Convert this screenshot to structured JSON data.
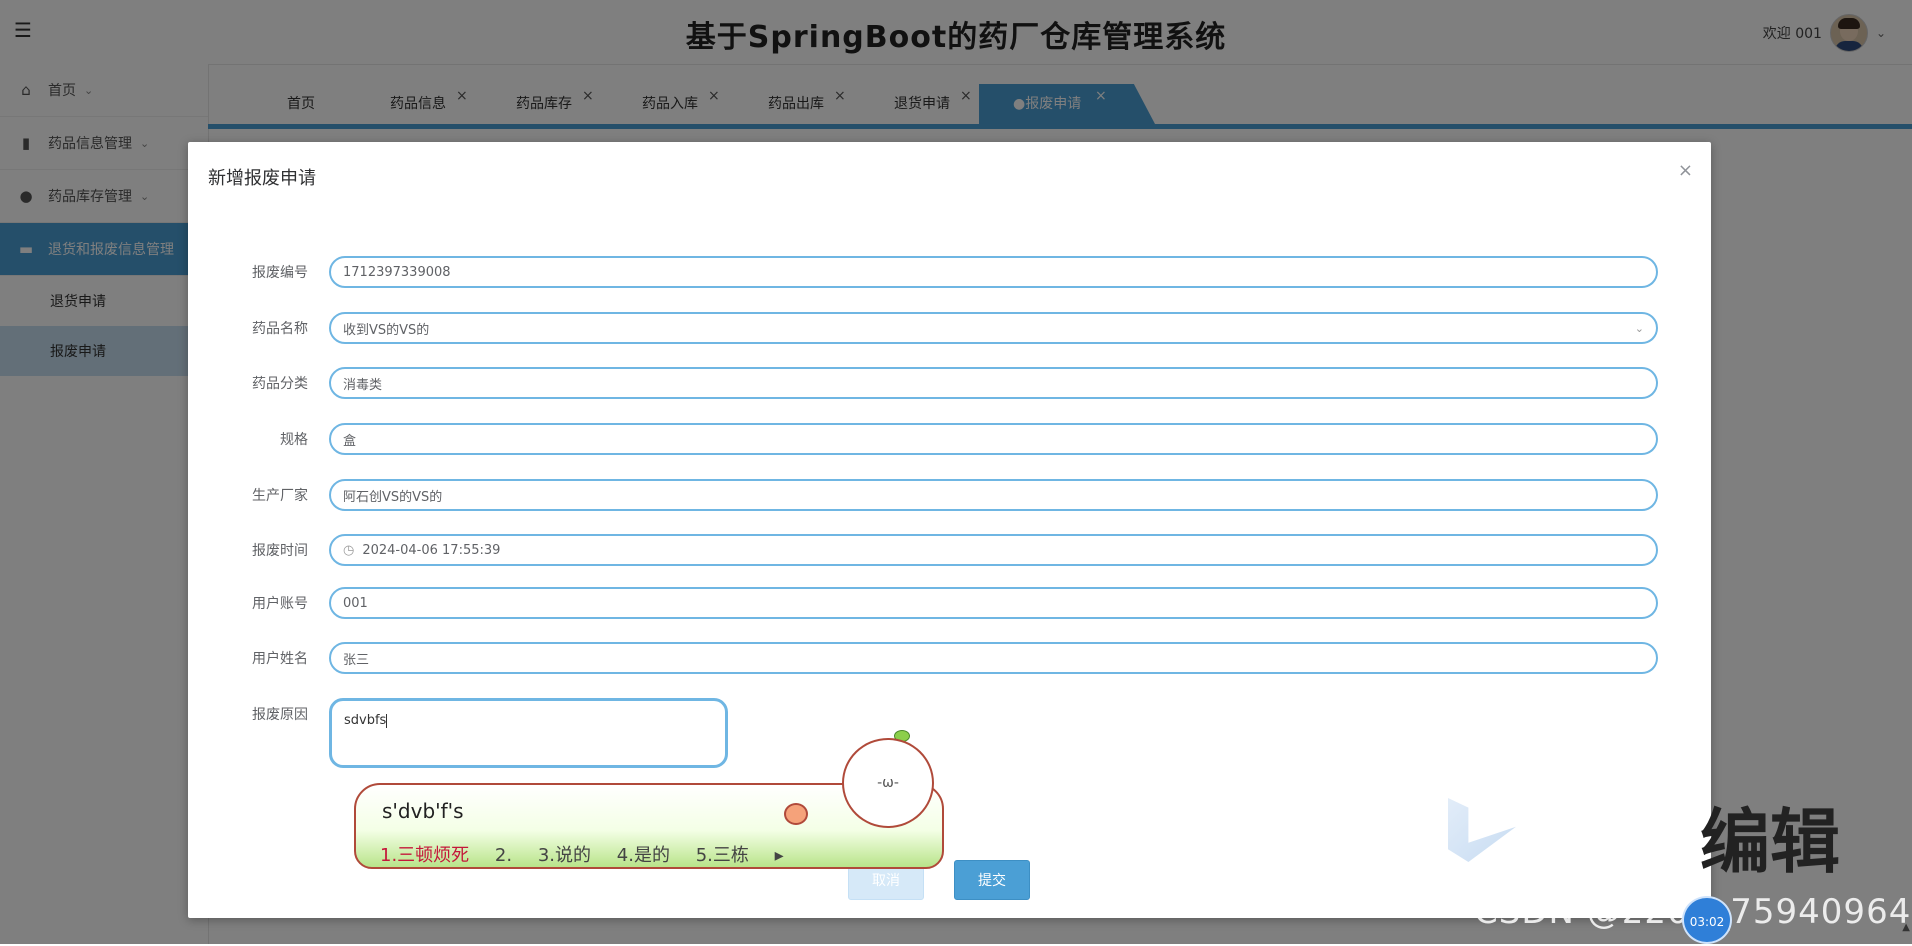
{
  "header": {
    "title": "基于SpringBoot的药厂仓库管理系统",
    "welcome": "欢迎 001"
  },
  "sidebar": {
    "items": [
      {
        "label": "首页",
        "icon": "home-icon"
      },
      {
        "label": "药品信息管理",
        "icon": "book-icon"
      },
      {
        "label": "药品库存管理",
        "icon": "circle-icon"
      },
      {
        "label": "退货和报废信息管理",
        "icon": "card-icon"
      }
    ],
    "subitems": [
      "退货申请",
      "报废申请"
    ]
  },
  "tabs": [
    {
      "label": "首页"
    },
    {
      "label": "药品信息"
    },
    {
      "label": "药品库存"
    },
    {
      "label": "药品入库"
    },
    {
      "label": "药品出库"
    },
    {
      "label": "退货申请"
    },
    {
      "label": "●报废申请"
    }
  ],
  "dialog": {
    "title": "新增报废申请",
    "fields": [
      {
        "label": "报废编号",
        "value": "1712397339008"
      },
      {
        "label": "药品名称",
        "value": "收到VS的VS的"
      },
      {
        "label": "药品分类",
        "value": "消毒类"
      },
      {
        "label": "规格",
        "value": "盒"
      },
      {
        "label": "生产厂家",
        "value": "阿石创VS的VS的"
      },
      {
        "label": "报废时间",
        "value": "2024-04-06 17:55:39"
      },
      {
        "label": "用户账号",
        "value": "001"
      },
      {
        "label": "用户姓名",
        "value": "张三"
      }
    ],
    "reason": {
      "label": "报废原因",
      "value": "sdvbfs"
    },
    "cancel_label": "取消",
    "submit_label": "提交"
  },
  "ime": {
    "composition": "s'dvb'f's",
    "candidates": [
      "1.三顿烦死",
      "2.",
      "3.说的",
      "4.是的",
      "5.三栋"
    ]
  },
  "overlay": {
    "watermark": "CSDN @2201_75940964",
    "edit_text": "编辑",
    "timer": "03:02",
    "mascot_face": "-ω-"
  },
  "colors": {
    "accent": "#4b9fd5",
    "field_border": "#6fb6e3",
    "ime_candidate": "#c4173a"
  }
}
